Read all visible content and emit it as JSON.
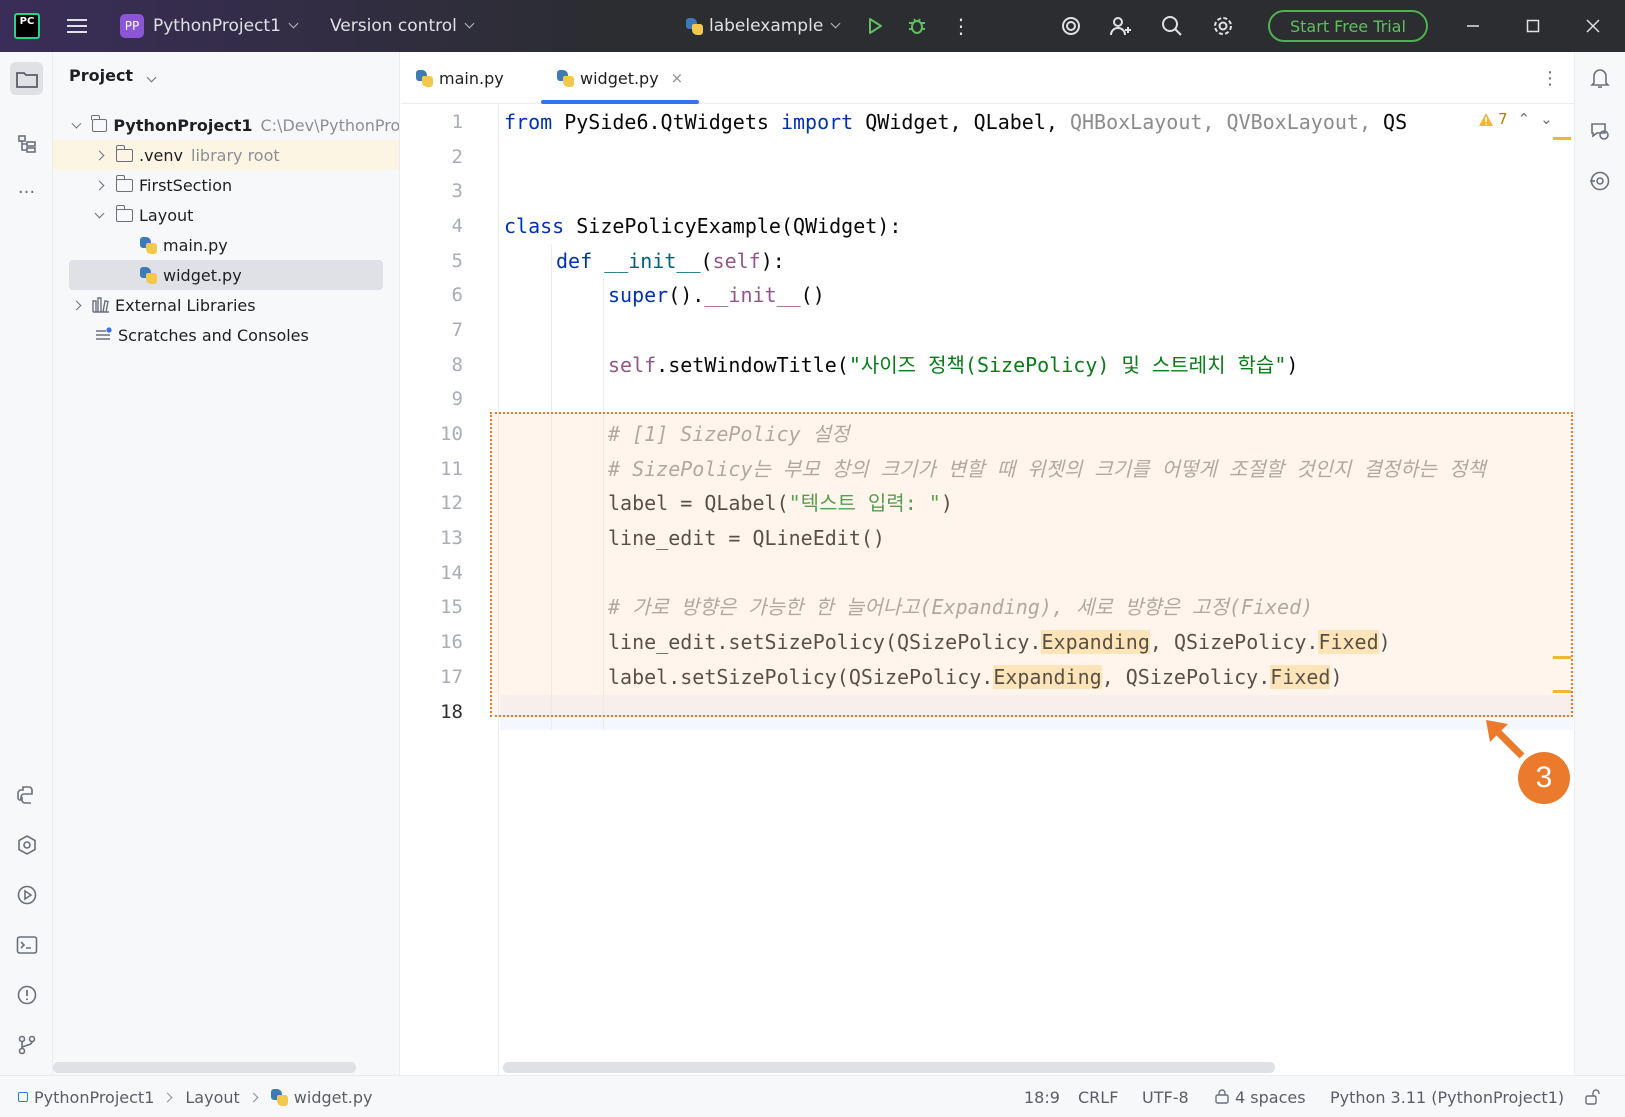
{
  "titlebar": {
    "app_logo": "PC",
    "menu_icon": "hamburger-icon",
    "project_badge": "PP",
    "project_name": "PythonProject1",
    "vcs_label": "Version control",
    "run_config": "labelexample",
    "trial_button": "Start Free Trial"
  },
  "project_panel": {
    "title": "Project",
    "tree": [
      {
        "label": "PythonProject1",
        "hint": "C:\\Dev\\PythonProj"
      },
      {
        "label": ".venv",
        "hint": "library root"
      },
      {
        "label": "FirstSection"
      },
      {
        "label": "Layout"
      },
      {
        "label": "main.py"
      },
      {
        "label": "widget.py"
      },
      {
        "label": "External Libraries"
      },
      {
        "label": "Scratches and Consoles"
      }
    ]
  },
  "editor": {
    "tabs": [
      {
        "label": "main.py"
      },
      {
        "label": "widget.py"
      }
    ],
    "close_glyph": "×",
    "problems_count": "7",
    "line_numbers": [
      "1",
      "2",
      "3",
      "4",
      "5",
      "6",
      "7",
      "8",
      "9",
      "10",
      "11",
      "12",
      "13",
      "14",
      "15",
      "16",
      "17",
      "18"
    ],
    "code": {
      "l1_from": "from",
      "l1_module": " PySide6.QtWidgets ",
      "l1_import": "import",
      "l1_used": " QWidget, QLabel, ",
      "l1_unused": "QHBoxLayout, QVBoxLayout,",
      "l1_tail": " QS",
      "l4_class": "class",
      "l4_rest": " SizePolicyExample(QWidget):",
      "l5_def": "def",
      "l5_name": "__init__",
      "l5_open": "(",
      "l5_self": "self",
      "l5_close": "):",
      "l6_super": "super",
      "l6_mid": "().",
      "l6_init": "__init__",
      "l6_end": "()",
      "l8_self": "self",
      "l8_call": ".setWindowTitle(",
      "l8_str": "\"사이즈 정책(SizePolicy) 및 스트레치 학습\"",
      "l8_end": ")",
      "l10": "# [1] SizePolicy 설정",
      "l11": "# SizePolicy는 부모 창의 크기가 변할 때 위젯의 크기를 어떻게 조절할 것인지 결정하는 정책",
      "l12_pre": "label = QLabel(",
      "l12_str": "\"텍스트 입력: \"",
      "l12_end": ")",
      "l13": "line_edit = QLineEdit()",
      "l15": "# 가로 방향은 가능한 한 늘어나고(Expanding), 세로 방향은 고정(Fixed)",
      "l16_pre": "line_edit.setSizePolicy(QSizePolicy.",
      "l16_exp": "Expanding",
      "l16_mid": ", QSizePolicy.",
      "l16_fix": "Fixed",
      "l16_end": ")",
      "l17_pre": "label.setSizePolicy(QSizePolicy.",
      "l17_exp": "Expanding",
      "l17_mid": ", QSizePolicy.",
      "l17_fix": "Fixed",
      "l17_end": ")"
    }
  },
  "callout_number": "3",
  "statusbar": {
    "breadcrumb": [
      "PythonProject1",
      "Layout",
      "widget.py"
    ],
    "position": "18:9",
    "line_ending": "CRLF",
    "encoding": "UTF-8",
    "indent": "4 spaces",
    "interpreter": "Python 3.11 (PythonProject1)"
  },
  "colors": {
    "accent": "#3574f0",
    "highlight_border": "#ec7a2c",
    "trial_green": "#4fb04f",
    "keyword": "#0033b3",
    "string": "#067d17",
    "comment": "#8c8c8c"
  }
}
